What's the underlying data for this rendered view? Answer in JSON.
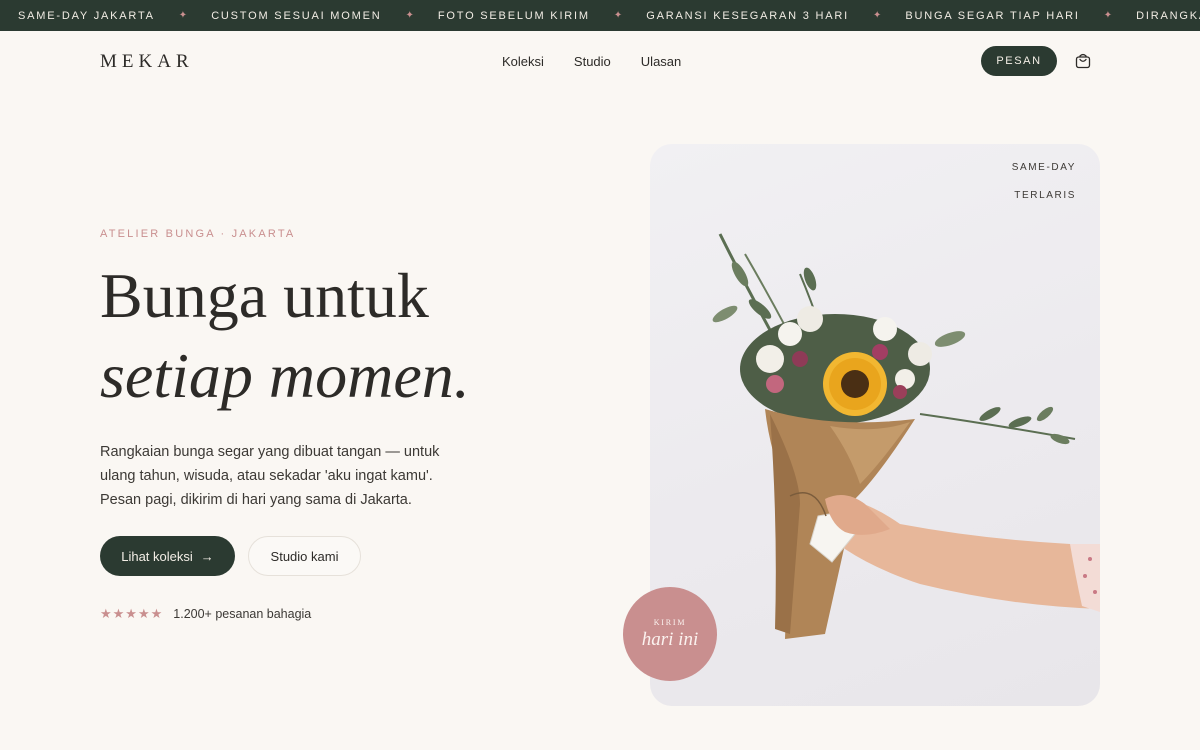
{
  "marquee": {
    "items": [
      "SAME-DAY JAKARTA",
      "CUSTOM SESUAI MOMEN",
      "FOTO SEBELUM KIRIM",
      "GARANSI KESEGARAN 3 HARI",
      "BUNGA SEGAR TIAP HARI",
      "DIRANGKAI TAN"
    ],
    "separator": "✦"
  },
  "header": {
    "logo": "MEKAR",
    "nav": [
      "Koleksi",
      "Studio",
      "Ulasan"
    ],
    "order_label": "PESAN",
    "cart_icon": "shopping-bag-icon"
  },
  "hero": {
    "eyebrow": "ATELIER BUNGA · JAKARTA",
    "title_line1": "Bunga untuk",
    "title_line2": "setiap momen.",
    "description": "Rangkaian bunga segar yang dibuat tangan — untuk ulang tahun, wisuda, atau sekadar 'aku ingat kamu'. Pesan pagi, dikirim di hari yang sama di Jakarta.",
    "primary_button": "Lihat koleksi",
    "primary_arrow": "→",
    "secondary_button": "Studio kami",
    "stars": "★★★★★",
    "rating_text": "1.200+ pesanan bahagia"
  },
  "card": {
    "tag1": "SAME-DAY",
    "tag2": "TERLARIS"
  },
  "badge": {
    "small": "KIRIM",
    "big": "hari ini"
  },
  "colors": {
    "background": "#faf7f3",
    "dark_green": "#2b3a31",
    "rose": "#c98f8f"
  }
}
